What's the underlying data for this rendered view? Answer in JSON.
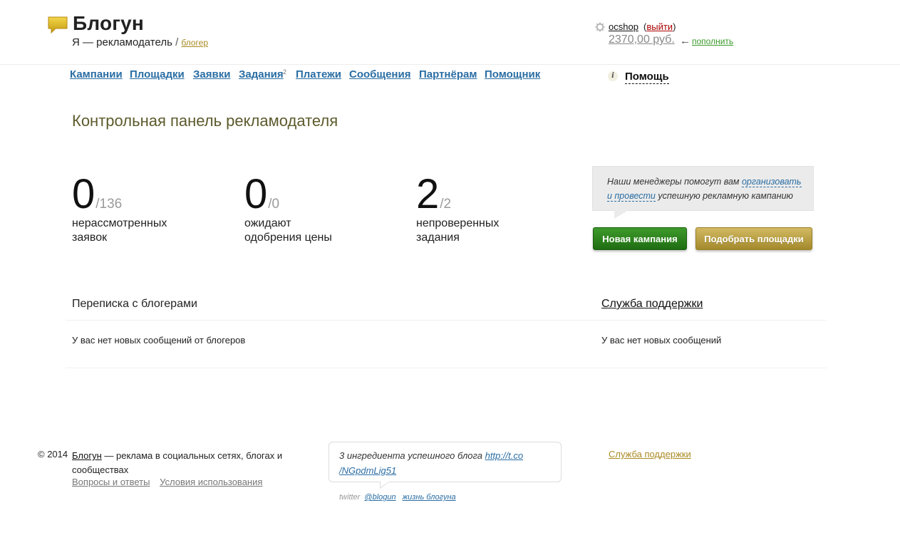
{
  "header": {
    "logo_title": "Блогун",
    "role_text": "Я — рекламодатель",
    "role_separator": "/",
    "switch_role_link": "блогер",
    "username": "ocshop",
    "logout_open": "(",
    "logout_link": "выйти",
    "logout_close": ")",
    "balance": "2370,00 руб.",
    "arrow": "←",
    "topup_link": "пополнить"
  },
  "nav": {
    "items": [
      "Кампании",
      "Площадки",
      "Заявки",
      "Задания",
      "Платежи",
      "Сообщения",
      "Партнёрам",
      "Помощник"
    ],
    "tasks_badge": "2",
    "help_icon": "i",
    "help_label": "Помощь"
  },
  "page_title": "Контрольная панель рекламодателя",
  "stats": [
    {
      "value": "0",
      "total": "/136",
      "label_line1": "нерассмотренных",
      "label_line2": "заявок"
    },
    {
      "value": "0",
      "total": "/0",
      "label_line1": "ожидают",
      "label_line2": "одобрения цены"
    },
    {
      "value": "2",
      "total": "/2",
      "label_line1": "непроверенных",
      "label_line2": "задания"
    }
  ],
  "callout": {
    "text_before": "Наши менеджеры помогут вам ",
    "link_part1": "организовать",
    "link_part2": "и провести",
    "text_after": " успешную рекламную кампанию"
  },
  "buttons": {
    "new_campaign": "Новая кампания",
    "pick_sites": "Подобрать площадки"
  },
  "messages": {
    "bloggers_title": "Переписка с блогерами",
    "bloggers_empty": "У вас нет новых сообщений от блогеров",
    "support_title": "Служба поддержки",
    "support_empty": "У вас нет новых сообщений"
  },
  "footer": {
    "copyright": "© 2014",
    "brand_link": "Блогун",
    "description": " — реклама в социальных сетях, блогах и сообществах",
    "faq_link": "Вопросы и ответы",
    "terms_link": "Условия использования",
    "tweet_text": "3 ингредиента успешного блога ",
    "tweet_link_line1": "http://t.co",
    "tweet_link_line2": "/NGpdmLig51",
    "twitter_label": "twitter",
    "twitter_handle": "@blogun",
    "blog_life_link": "жизнь блогуна",
    "support_link": "Служба поддержки"
  },
  "colors": {
    "nav_link": "#2a6da3",
    "title": "#5d5a2c",
    "green_button": "#2f8420",
    "gold_button": "#bca247",
    "gold_link": "#a98b24"
  }
}
